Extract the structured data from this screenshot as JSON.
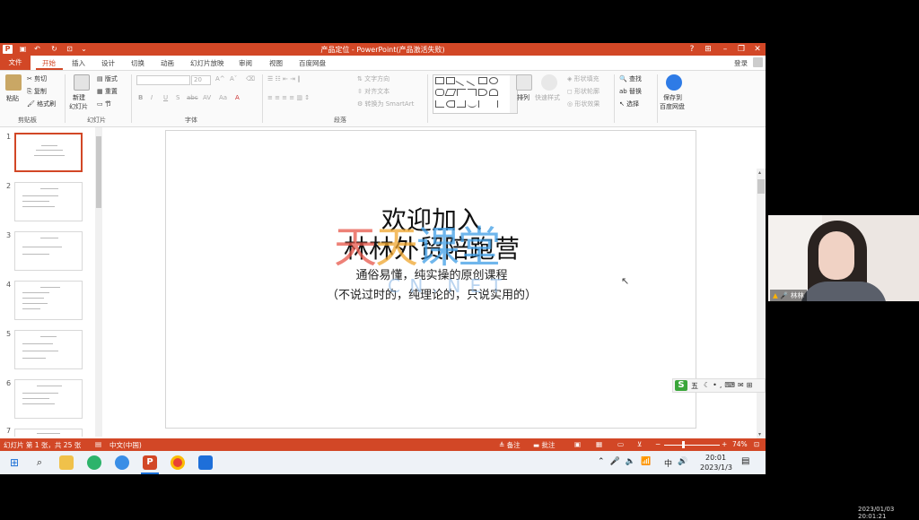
{
  "window": {
    "title": "产品定位 - PowerPoint(产品激活失败)",
    "help": "?",
    "login": "登录"
  },
  "ribbon_tabs": [
    "文件",
    "开始",
    "插入",
    "设计",
    "切换",
    "动画",
    "幻灯片放映",
    "审阅",
    "视图",
    "百度网盘"
  ],
  "clipboard": {
    "paste": "粘贴",
    "cut": "剪切",
    "copy": "复制",
    "format_painter": "格式刷",
    "group": "剪贴板"
  },
  "slides_group": {
    "new_slide_1": "新建",
    "new_slide_2": "幻灯片",
    "layout": "版式",
    "reset": "重置",
    "section": "节",
    "group": "幻灯片"
  },
  "font_group": {
    "size": "20",
    "bold": "B",
    "italic": "I",
    "underline": "U",
    "strike": "S",
    "shadow": "abc",
    "spacing": "AV",
    "case": "Aa",
    "color": "A",
    "group": "字体"
  },
  "paragraph_group": {
    "text_direction": "文字方向",
    "align_text": "对齐文本",
    "smartart": "转换为 SmartArt",
    "group": "段落"
  },
  "drawing_group": {
    "arrange": "排列",
    "quick_styles": "快速样式",
    "shape_fill": "形状填充",
    "shape_outline": "形状轮廓",
    "shape_effects": "形状效果"
  },
  "editing_group": {
    "find": "查找",
    "replace": "替换",
    "select": "选择"
  },
  "baidu_group": {
    "save_1": "保存到",
    "save_2": "百度网盘"
  },
  "thumbnails": [
    {
      "num": "1"
    },
    {
      "num": "2"
    },
    {
      "num": "3"
    },
    {
      "num": "4"
    },
    {
      "num": "5"
    },
    {
      "num": "6"
    },
    {
      "num": "7"
    }
  ],
  "slide": {
    "title_line1": "欢迎加入",
    "title_line2": "林林外贸陪跑营",
    "subtitle_line1": "通俗易懂，纯实操的原创课程",
    "subtitle_line2": "（不说过时的，纯理论的，只说实用的）"
  },
  "watermark": {
    "chars": [
      "天",
      "天",
      "课",
      "堂"
    ],
    "colors": [
      "#e8574a",
      "#f0a62e",
      "#3f9ee6",
      "#3f9ee6"
    ],
    "url": "C N . N E T"
  },
  "ime": {
    "label": "五"
  },
  "status": {
    "slide_counter": "幻灯片 第 1 张，共 25 张",
    "language": "中文(中国)",
    "notes": "备注",
    "comments": "批注",
    "zoom": "74%"
  },
  "taskbar": {
    "time": "20:01",
    "date": "2023/1/3",
    "ime": "中"
  },
  "webcam": {
    "name": "林林"
  },
  "recording_stamp": "2023/01/03 20:01:21",
  "colors": {
    "accent": "#d24726"
  }
}
